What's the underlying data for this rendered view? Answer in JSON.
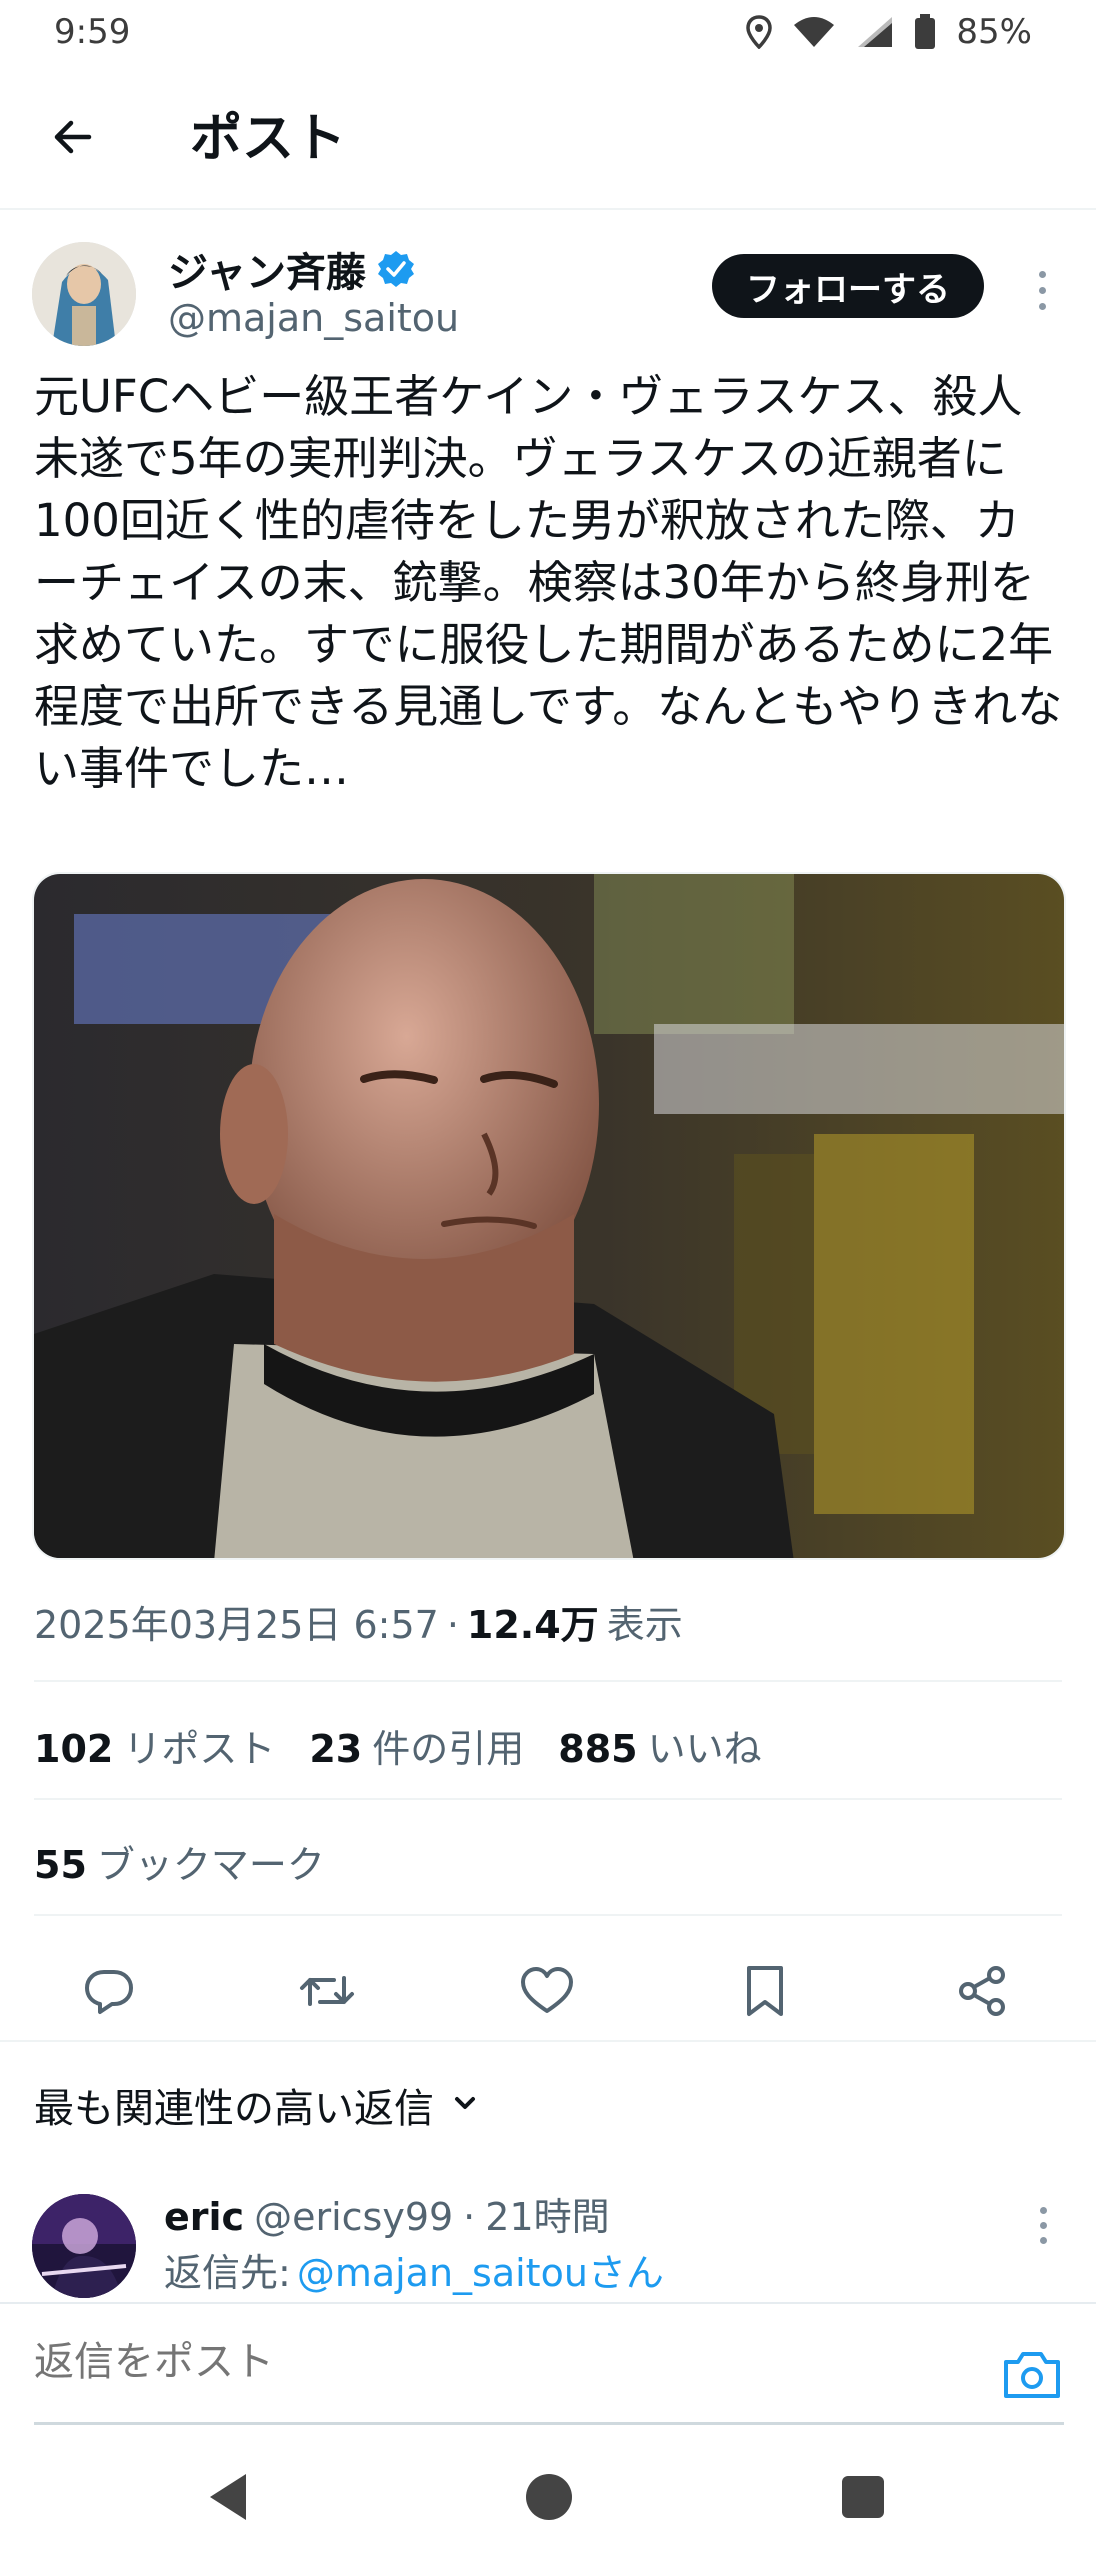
{
  "status_bar": {
    "time": "9:59",
    "battery": "85%",
    "icons": [
      "location-icon",
      "wifi-icon",
      "signal-icon",
      "battery-icon"
    ]
  },
  "header": {
    "title": "ポスト",
    "back_icon": "arrow-left-icon"
  },
  "author": {
    "name": "ジャン斉藤",
    "handle": "@majan_saitou",
    "verified": true,
    "follow_label": "フォローする"
  },
  "tweet": {
    "text": "元UFCヘビー級王者ケイン・ヴェラスケス、殺人未遂で5年の実刑判決。ヴェラスケスの近親者に100回近く性的虐待をした男が釈放された際、カーチェイスの末、銃撃。検察は30年から終身刑を求めていた。すでに服役した期間があるために2年程度で出所できる見通しです。なんともやりきれない事件でした…",
    "timestamp": "2025年03月25日 6:57",
    "separator": "·",
    "views_count": "12.4万",
    "views_label": "表示"
  },
  "stats": {
    "reposts_count": "102",
    "reposts_label": "リポスト",
    "quotes_count": "23",
    "quotes_label": "件の引用",
    "likes_count": "885",
    "likes_label": "いいね",
    "bookmarks_count": "55",
    "bookmarks_label": "ブックマーク"
  },
  "actions": [
    "reply-icon",
    "repost-icon",
    "like-icon",
    "bookmark-icon",
    "share-icon"
  ],
  "replies_filter": {
    "label": "最も関連性の高い返信"
  },
  "reply": {
    "name": "eric",
    "handle": "@ericsy99",
    "separator": "·",
    "time": "21時間",
    "reply_to_prefix": "返信先:",
    "reply_to_handle": "@majan_saitouさん"
  },
  "compose": {
    "placeholder": "返信をポスト"
  },
  "colors": {
    "text_primary": "#0f1419",
    "text_secondary": "#536471",
    "link": "#1d9bf0",
    "verified": "#1d9bf0",
    "follow_bg": "#0f1419"
  }
}
